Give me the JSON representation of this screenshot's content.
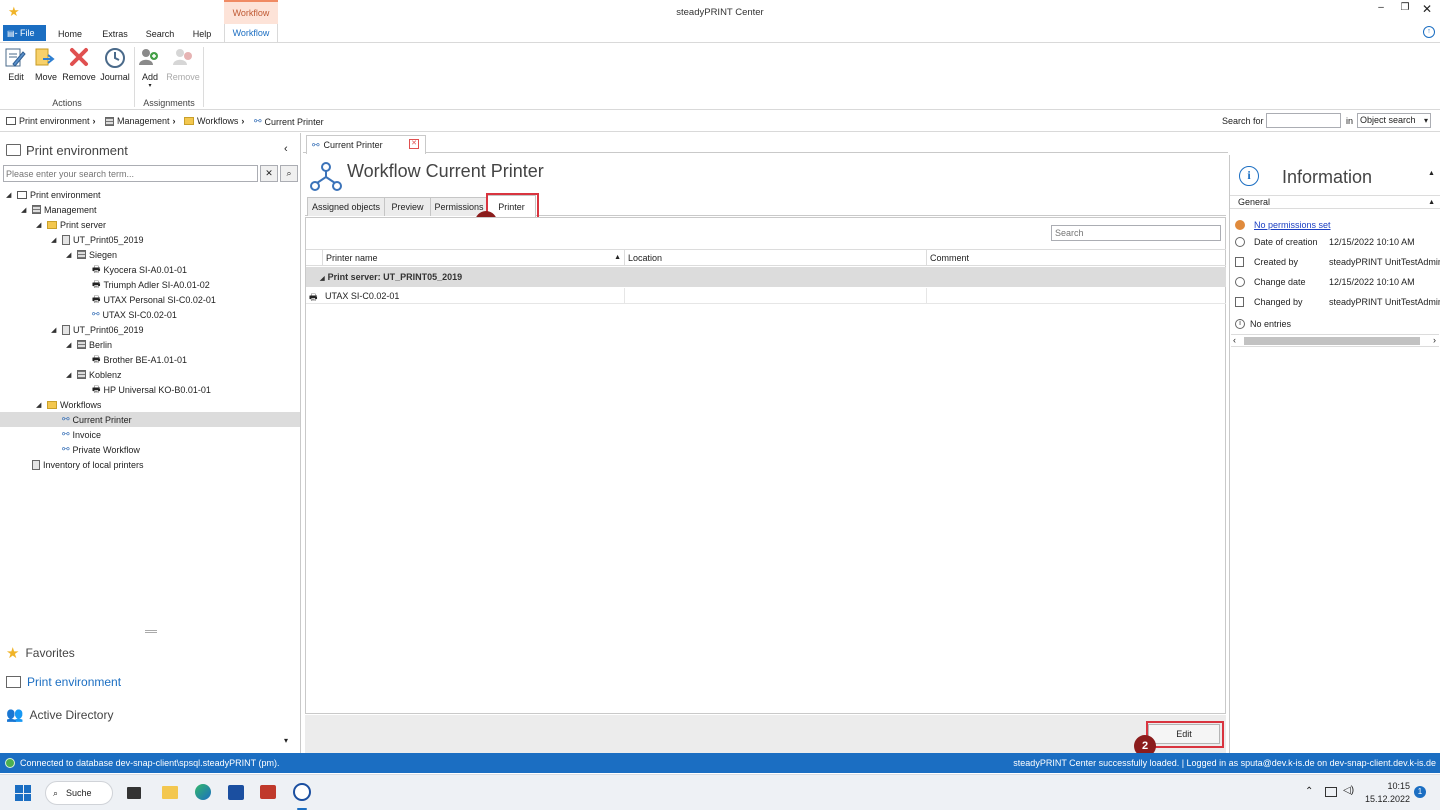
{
  "window": {
    "title": "steadyPRINT Center"
  },
  "ribbon": {
    "tabs": [
      "Home",
      "Extras",
      "Search",
      "Help"
    ],
    "file_label": "- File",
    "context_group": "Workflow",
    "active_tab": "Workflow",
    "actions": {
      "edit": "Edit",
      "move": "Move",
      "remove": "Remove",
      "journal": "Journal",
      "group": "Actions"
    },
    "assignments": {
      "add": "Add",
      "remove": "Remove",
      "group": "Assignments"
    }
  },
  "breadcrumb": {
    "items": [
      "Print environment",
      "Management",
      "Workflows",
      "Current Printer"
    ],
    "search_label": "Search for",
    "search_value": "",
    "in_label": "in",
    "scope": "Object search"
  },
  "left_panel": {
    "title": "Print environment",
    "search_placeholder": "Please enter your search term...",
    "tree": [
      {
        "label": "Print environment",
        "depth": 0,
        "icon": "environment-icon",
        "expanded": true
      },
      {
        "label": "Management",
        "depth": 1,
        "icon": "building-icon",
        "expanded": true
      },
      {
        "label": "Print server",
        "depth": 2,
        "icon": "folder-icon",
        "expanded": true
      },
      {
        "label": "UT_Print05_2019",
        "depth": 3,
        "icon": "server-icon",
        "expanded": true
      },
      {
        "label": "Siegen",
        "depth": 4,
        "icon": "building-icon",
        "expanded": true
      },
      {
        "label": "Kyocera SI-A0.01-01",
        "depth": 5,
        "icon": "printer-icon"
      },
      {
        "label": "Triumph Adler SI-A0.01-02",
        "depth": 5,
        "icon": "printer-icon"
      },
      {
        "label": "UTAX Personal SI-C0.02-01",
        "depth": 5,
        "icon": "printer-icon"
      },
      {
        "label": "UTAX SI-C0.02-01",
        "depth": 5,
        "icon": "workflow-icon"
      },
      {
        "label": "UT_Print06_2019",
        "depth": 3,
        "icon": "server-icon",
        "expanded": true
      },
      {
        "label": "Berlin",
        "depth": 4,
        "icon": "building-icon",
        "expanded": true
      },
      {
        "label": "Brother BE-A1.01-01",
        "depth": 5,
        "icon": "printer-icon"
      },
      {
        "label": "Koblenz",
        "depth": 4,
        "icon": "building-icon",
        "expanded": true
      },
      {
        "label": "HP Universal KO-B0.01-01",
        "depth": 5,
        "icon": "printer-icon"
      },
      {
        "label": "Workflows",
        "depth": 2,
        "icon": "folder-icon",
        "expanded": true
      },
      {
        "label": "Current Printer",
        "depth": 3,
        "icon": "workflow-icon",
        "selected": true
      },
      {
        "label": "Invoice",
        "depth": 3,
        "icon": "workflow-icon"
      },
      {
        "label": "Private Workflow",
        "depth": 3,
        "icon": "workflow-icon"
      },
      {
        "label": "Inventory of local printers",
        "depth": 1,
        "icon": "server-icon"
      }
    ],
    "nav": [
      "Favorites",
      "Print environment",
      "Active Directory"
    ]
  },
  "document": {
    "tab_label": "Current Printer",
    "heading": "Workflow Current Printer",
    "subtabs": [
      "Assigned objects",
      "Preview",
      "Permissions",
      "Printer"
    ],
    "active_subtab": "Printer",
    "grid_search_placeholder": "Search",
    "columns": [
      "Printer name",
      "Location",
      "Comment"
    ],
    "group_row": "Print server: UT_PRINT05_2019",
    "rows": [
      {
        "name": "UTAX SI-C0.02-01",
        "location": "",
        "comment": ""
      }
    ],
    "edit_button": "Edit",
    "markers": [
      "1",
      "2"
    ]
  },
  "info_panel": {
    "title": "Information",
    "section": "General",
    "permissions_link": "No permissions set",
    "rows": [
      {
        "label": "Date of creation",
        "value": "12/15/2022 10:10 AM"
      },
      {
        "label": "Created by",
        "value": "steadyPRINT UnitTestAdmin"
      },
      {
        "label": "Change date",
        "value": "12/15/2022 10:10 AM"
      },
      {
        "label": "Changed by",
        "value": "steadyPRINT UnitTestAdmin"
      }
    ],
    "no_entries": "No entries"
  },
  "statusbar": {
    "left": "Connected to database dev-snap-client\\spsql.steadyPRINT (pm).",
    "right": "steadyPRINT Center successfully loaded. | Logged in as sputa@dev.k-is.de on dev-snap-client.dev.k-is.de"
  },
  "taskbar": {
    "search_label": "Suche",
    "time": "10:15",
    "date": "15.12.2022",
    "notification_count": "1"
  },
  "colors": {
    "accent": "#1b6ec2",
    "marker": "#8b1c1c",
    "context_tab": "#fde3d8",
    "highlight_box": "#d9343f"
  }
}
